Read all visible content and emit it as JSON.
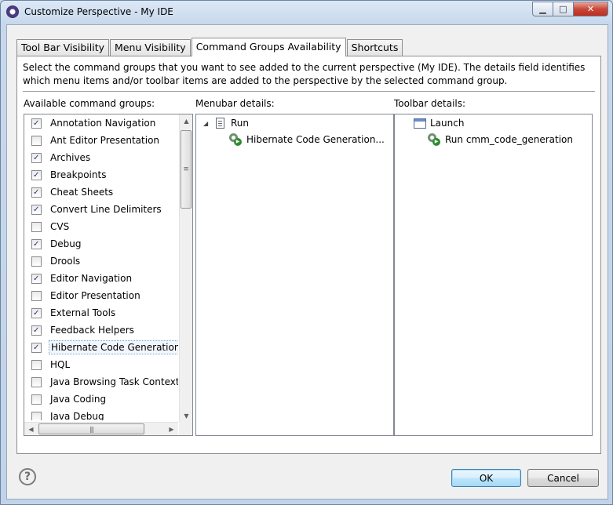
{
  "window": {
    "title": "Customize Perspective - My IDE"
  },
  "tabs": [
    {
      "label": "Tool Bar Visibility"
    },
    {
      "label": "Menu Visibility"
    },
    {
      "label": "Command Groups Availability",
      "active": true
    },
    {
      "label": "Shortcuts"
    }
  ],
  "description": "Select the command groups that you want to see added to the current perspective (My IDE).  The details field identifies which menu items and/or toolbar items are added to the perspective by the selected command group.",
  "columns": {
    "available": "Available command groups:",
    "menubar": "Menubar details:",
    "toolbar": "Toolbar details:"
  },
  "command_groups": [
    {
      "label": "Annotation Navigation",
      "checked": true
    },
    {
      "label": "Ant Editor Presentation",
      "checked": false
    },
    {
      "label": "Archives",
      "checked": true
    },
    {
      "label": "Breakpoints",
      "checked": true
    },
    {
      "label": "Cheat Sheets",
      "checked": true
    },
    {
      "label": "Convert Line Delimiters",
      "checked": true
    },
    {
      "label": "CVS",
      "checked": false
    },
    {
      "label": "Debug",
      "checked": true
    },
    {
      "label": "Drools",
      "checked": false
    },
    {
      "label": "Editor Navigation",
      "checked": true
    },
    {
      "label": "Editor Presentation",
      "checked": false
    },
    {
      "label": "External Tools",
      "checked": true
    },
    {
      "label": "Feedback Helpers",
      "checked": true
    },
    {
      "label": "Hibernate Code Generation",
      "checked": true,
      "selected": true
    },
    {
      "label": "HQL",
      "checked": false
    },
    {
      "label": "Java Browsing Task Context",
      "checked": false
    },
    {
      "label": "Java Coding",
      "checked": false
    },
    {
      "label": "Java Debug",
      "checked": false
    }
  ],
  "menubar_tree": {
    "root": {
      "label": "Run",
      "icon": "document-icon",
      "expanded": true
    },
    "child": {
      "label": "Hibernate Code Generation...",
      "icon": "run-config-icon"
    }
  },
  "toolbar_tree": {
    "root": {
      "label": "Launch",
      "icon": "launch-icon"
    },
    "child": {
      "label": "Run cmm_code_generation",
      "icon": "run-config-icon"
    }
  },
  "buttons": {
    "ok": "OK",
    "cancel": "Cancel",
    "help": "?"
  },
  "colors": {
    "title_bar": "#c7d8ec",
    "ok_highlight": "#3c7fb1",
    "checkmark": "#1c3b7a"
  }
}
